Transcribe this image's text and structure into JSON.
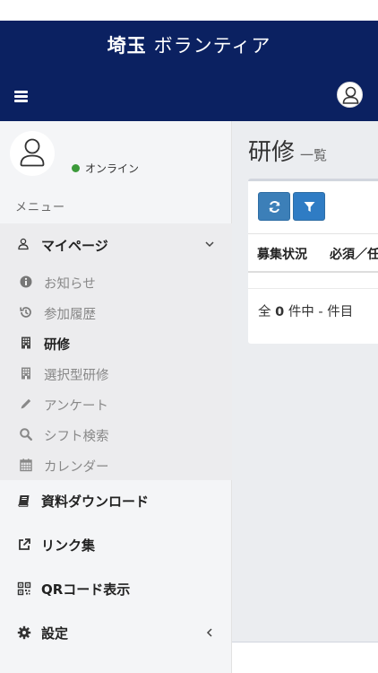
{
  "header": {
    "brand_bold": "埼玉",
    "brand_rest": "ボランティア",
    "menu_icon": "hamburger-icon",
    "avatar_icon": "user-avatar-icon",
    "bg_color": "#0b2161"
  },
  "user_panel": {
    "status_text": "オンライン",
    "status_color": "#3c9a3a"
  },
  "sidebar": {
    "menu_header": "メニュー",
    "mypage": {
      "label": "マイページ",
      "icon": "user-icon",
      "children": [
        {
          "label": "お知らせ",
          "icon": "info-circle-icon",
          "active": false
        },
        {
          "label": "参加履歴",
          "icon": "history-icon",
          "active": false
        },
        {
          "label": "研修",
          "icon": "building-icon",
          "active": true
        },
        {
          "label": "選択型研修",
          "icon": "building-icon",
          "active": false
        },
        {
          "label": "アンケート",
          "icon": "pencil-icon",
          "active": false
        },
        {
          "label": "シフト検索",
          "icon": "search-icon",
          "active": false
        },
        {
          "label": "カレンダー",
          "icon": "calendar-icon",
          "active": false
        }
      ]
    },
    "items": [
      {
        "label": "資料ダウンロード",
        "icon": "book-icon"
      },
      {
        "label": "リンク集",
        "icon": "external-link-icon"
      },
      {
        "label": "QRコード表示",
        "icon": "qrcode-icon"
      },
      {
        "label": "設定",
        "icon": "gear-icon"
      }
    ]
  },
  "main": {
    "title": "研修",
    "subtitle": "一覧",
    "buttons": {
      "refresh_icon": "refresh-icon",
      "filter_icon": "filter-icon"
    },
    "table": {
      "columns": [
        "募集状況",
        "必須／任"
      ]
    },
    "summary": {
      "prefix": "全",
      "count": "0",
      "suffix": "件中 - 件目"
    }
  }
}
